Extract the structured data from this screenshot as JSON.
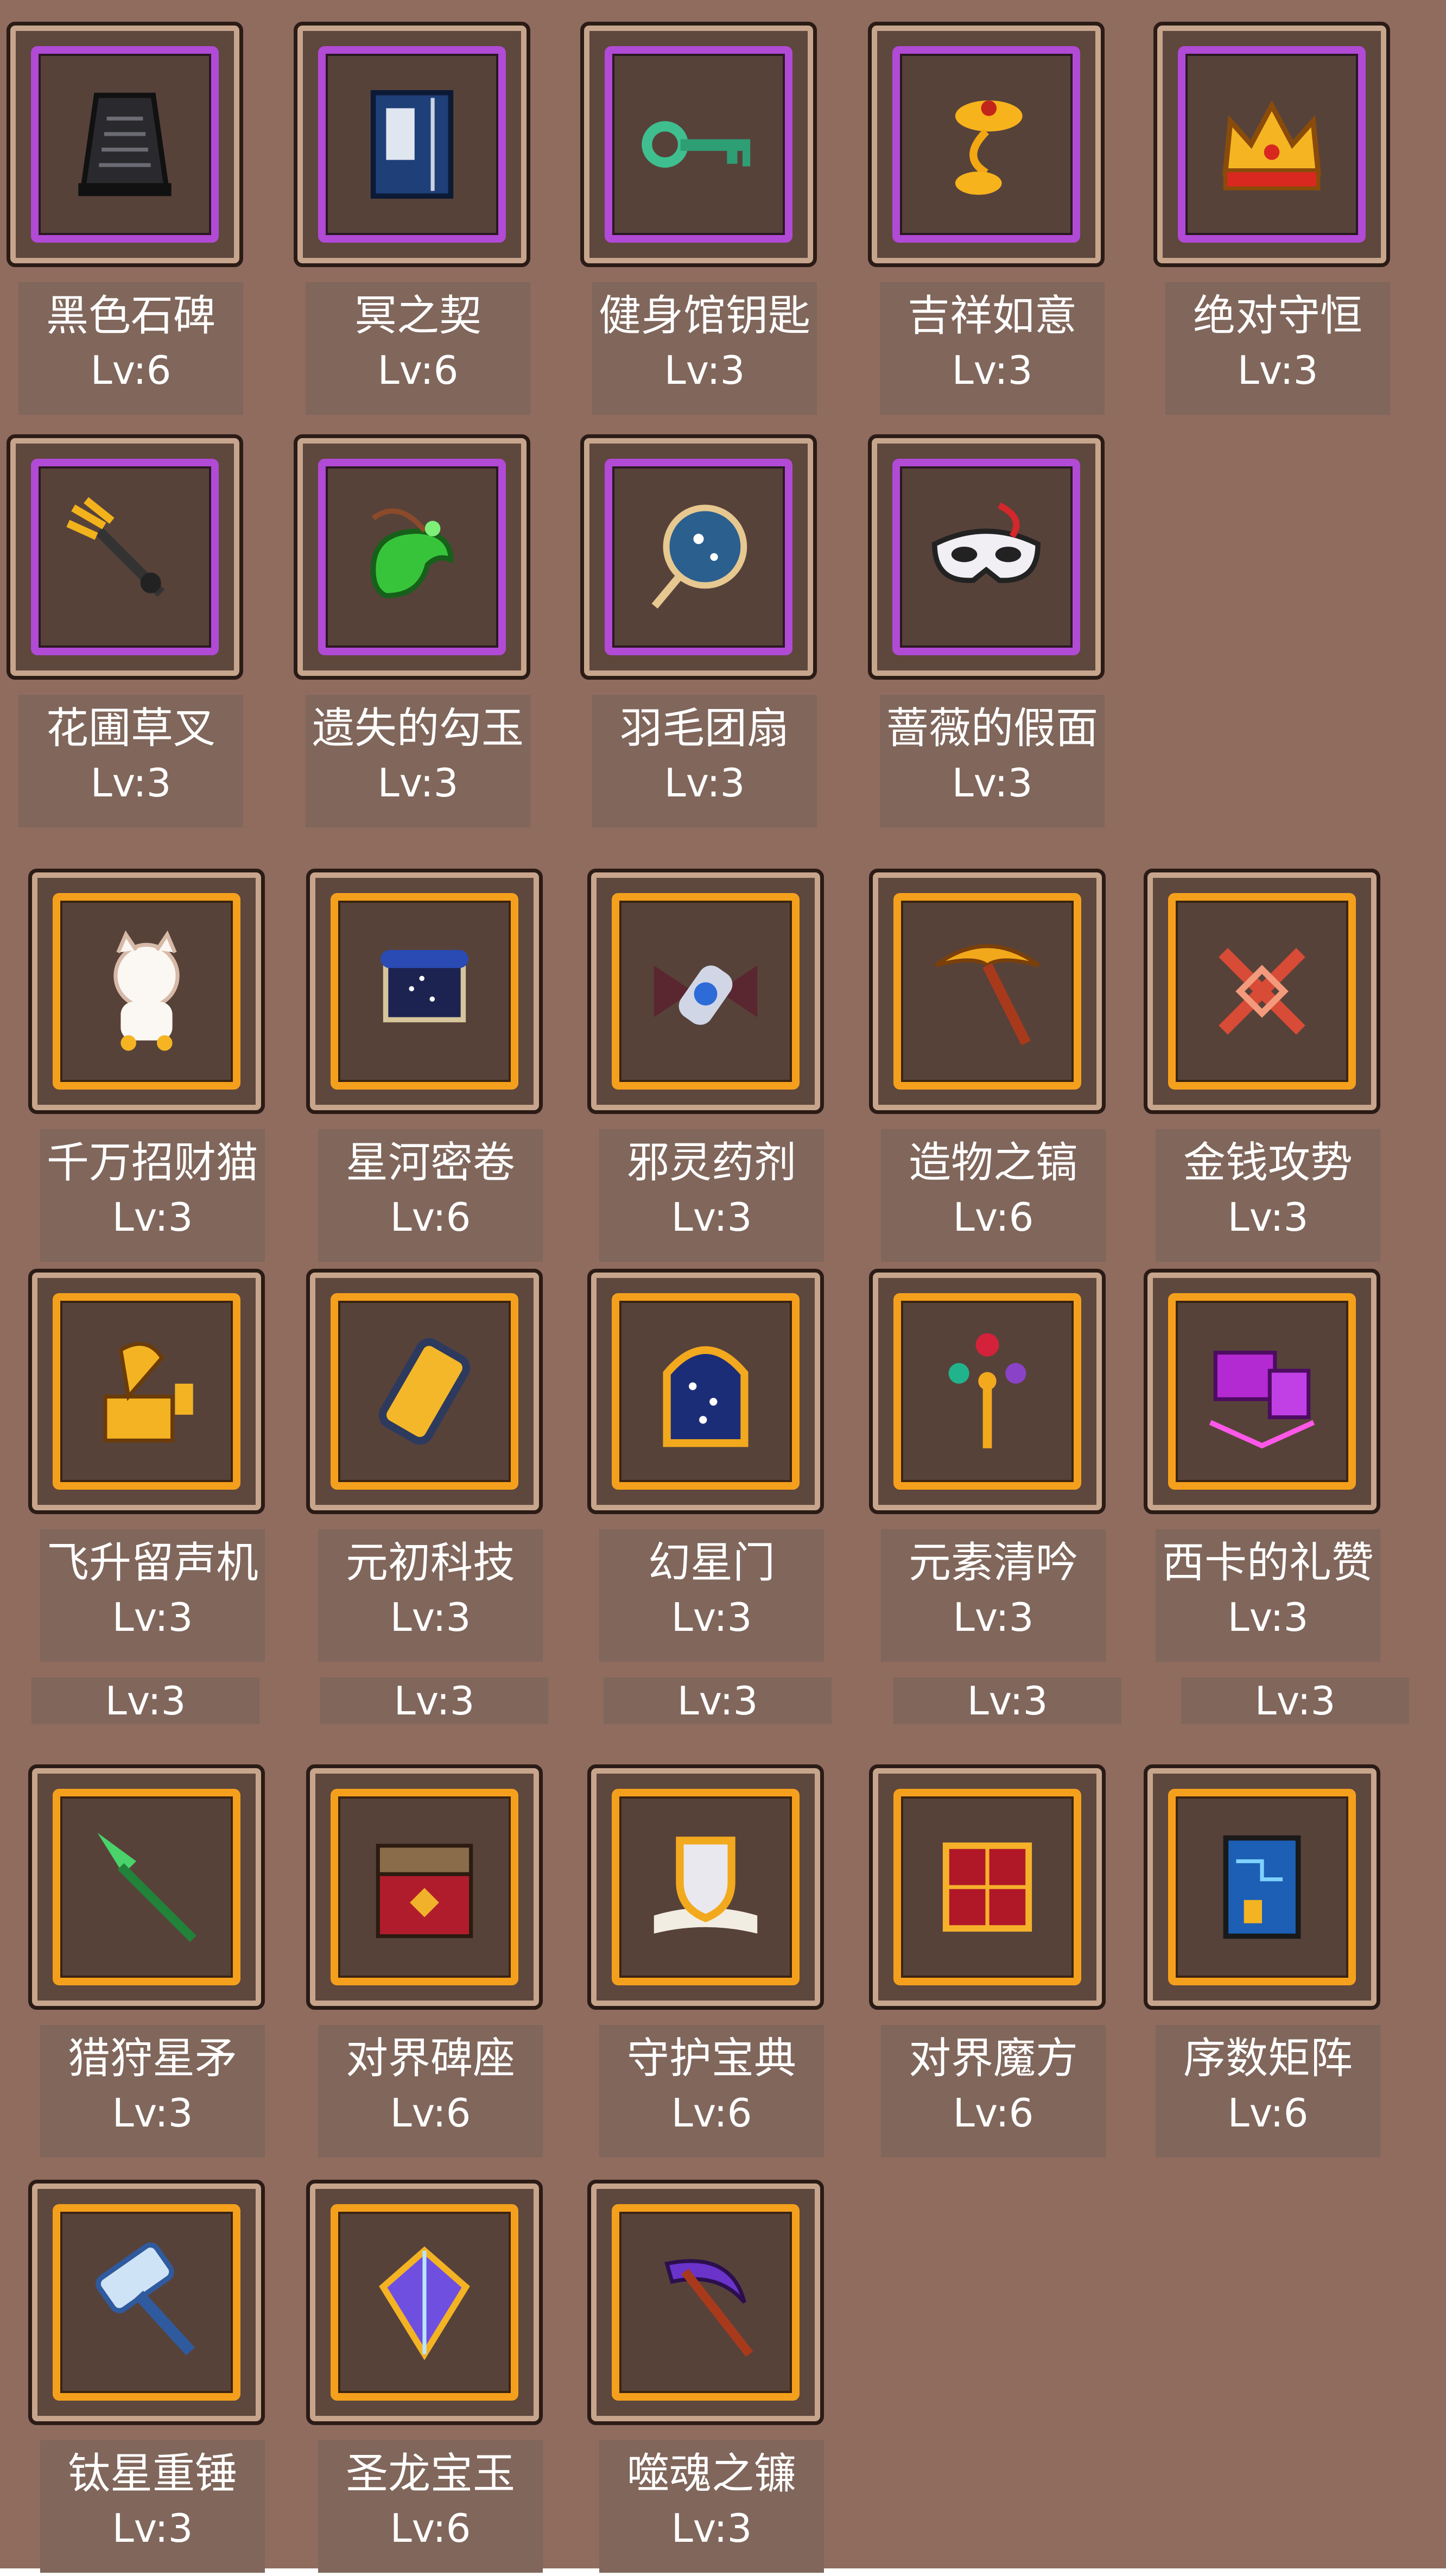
{
  "sections": [
    {
      "frame_color": "purple",
      "items": [
        {
          "name": "黑色石碑",
          "level": "Lv:6",
          "icon": "stone-tablet-icon"
        },
        {
          "name": "冥之契",
          "level": "Lv:6",
          "icon": "book-icon"
        },
        {
          "name": "健身馆钥匙",
          "level": "Lv:3",
          "icon": "key-icon"
        },
        {
          "name": "吉祥如意",
          "level": "Lv:3",
          "icon": "ruyi-icon"
        },
        {
          "name": "绝对守恒",
          "level": "Lv:3",
          "icon": "crown-icon"
        },
        {
          "name": "花圃草叉",
          "level": "Lv:3",
          "icon": "pitchfork-icon"
        },
        {
          "name": "遗失的勾玉",
          "level": "Lv:3",
          "icon": "magatama-icon"
        },
        {
          "name": "羽毛团扇",
          "level": "Lv:3",
          "icon": "round-fan-icon"
        },
        {
          "name": "蔷薇的假面",
          "level": "Lv:3",
          "icon": "mask-icon"
        }
      ]
    },
    {
      "frame_color": "orange",
      "items": [
        {
          "name": "千万招财猫",
          "level": "Lv:3",
          "icon": "lucky-cat-icon"
        },
        {
          "name": "星河密卷",
          "level": "Lv:6",
          "icon": "scroll-icon"
        },
        {
          "name": "邪灵药剂",
          "level": "Lv:3",
          "icon": "potion-icon"
        },
        {
          "name": "造物之镐",
          "level": "Lv:6",
          "icon": "pickaxe-icon"
        },
        {
          "name": "金钱攻势",
          "level": "Lv:3",
          "icon": "knot-icon"
        },
        {
          "name": "飞升留声机",
          "level": "Lv:3",
          "icon": "gramophone-icon"
        },
        {
          "name": "元初科技",
          "level": "Lv:3",
          "icon": "battery-icon"
        },
        {
          "name": "幻星门",
          "level": "Lv:3",
          "icon": "star-gate-icon"
        },
        {
          "name": "元素清吟",
          "level": "Lv:3",
          "icon": "elemental-staff-icon"
        },
        {
          "name": "西卡的礼赞",
          "level": "Lv:3",
          "icon": "magic-cube-icon"
        },
        {
          "name": "猎狩星矛",
          "level": "Lv:3",
          "icon": "spear-icon"
        },
        {
          "name": "对界碑座",
          "level": "Lv:6",
          "icon": "chest-icon"
        },
        {
          "name": "守护宝典",
          "level": "Lv:6",
          "icon": "shield-book-icon"
        },
        {
          "name": "对界魔方",
          "level": "Lv:6",
          "icon": "red-cube-icon"
        },
        {
          "name": "序数矩阵",
          "level": "Lv:6",
          "icon": "circuit-card-icon"
        },
        {
          "name": "钛星重锤",
          "level": "Lv:3",
          "icon": "hammer-icon"
        },
        {
          "name": "圣龙宝玉",
          "level": "Lv:6",
          "icon": "dragon-gem-icon"
        },
        {
          "name": "噬魂之镰",
          "level": "Lv:3",
          "icon": "scythe-icon"
        }
      ]
    }
  ],
  "extra_strip": [
    "Lv:3",
    "Lv:3",
    "Lv:3",
    "Lv:3",
    "Lv:3"
  ]
}
